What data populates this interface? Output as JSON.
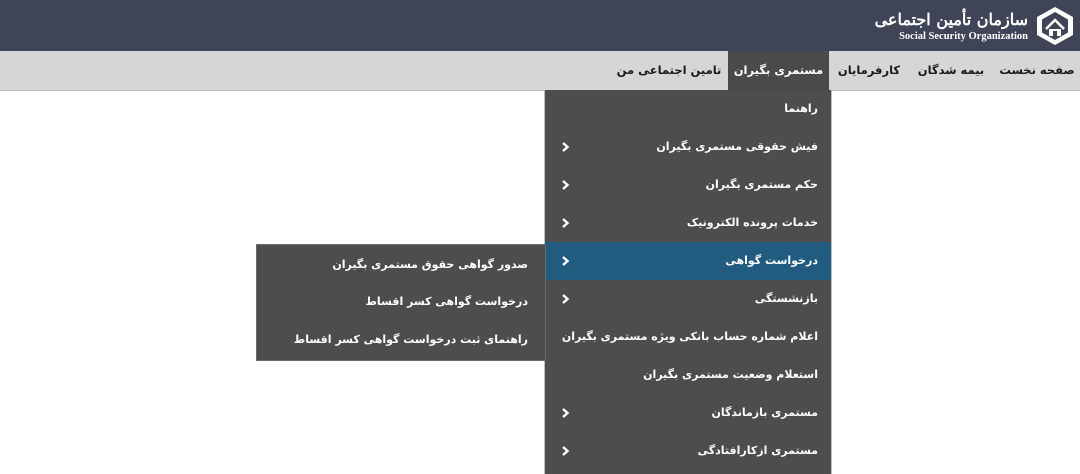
{
  "header": {
    "logo_fa": "سازمان تأمین اجتماعی",
    "logo_en": "Social Security Organization",
    "logo_icon": "ssorg-emblem-icon"
  },
  "nav": {
    "items": [
      {
        "label": "صفحه نخست"
      },
      {
        "label": "بیمه شدگان"
      },
      {
        "label": "کارفرمایان"
      },
      {
        "label": "مستمری بگیران"
      },
      {
        "label": "تامین اجتماعی من"
      }
    ],
    "active_index": 3
  },
  "menu": {
    "items": [
      {
        "label": "راهنما",
        "has_submenu": false
      },
      {
        "label": "فیش حقوقی مستمری بگیران",
        "has_submenu": true
      },
      {
        "label": "حکم مستمری بگیران",
        "has_submenu": true
      },
      {
        "label": "خدمات پرونده الکترونیک",
        "has_submenu": true
      },
      {
        "label": "درخواست گواهی",
        "has_submenu": true
      },
      {
        "label": "بازنشستگی",
        "has_submenu": true
      },
      {
        "label": "اعلام شماره حساب بانکی ویژه مستمری بگیران",
        "has_submenu": false
      },
      {
        "label": "استعلام وضعیت مستمری بگیران",
        "has_submenu": false
      },
      {
        "label": "مستمری بازماندگان",
        "has_submenu": true
      },
      {
        "label": "مستمری ازکارافتادگی",
        "has_submenu": true
      }
    ],
    "active_index": 4
  },
  "submenu": {
    "items": [
      {
        "label": "صدور گواهی حقوق مستمری بگیران"
      },
      {
        "label": "درخواست گواهی کسر اقساط"
      },
      {
        "label": "راهنمای ثبت درخواست گواهی کسر اقساط"
      }
    ]
  },
  "colors": {
    "header_bg": "#3f4556",
    "nav_bg": "#d6d6d6",
    "menu_bg": "#4d4d4d",
    "active_bg": "#215c80"
  }
}
